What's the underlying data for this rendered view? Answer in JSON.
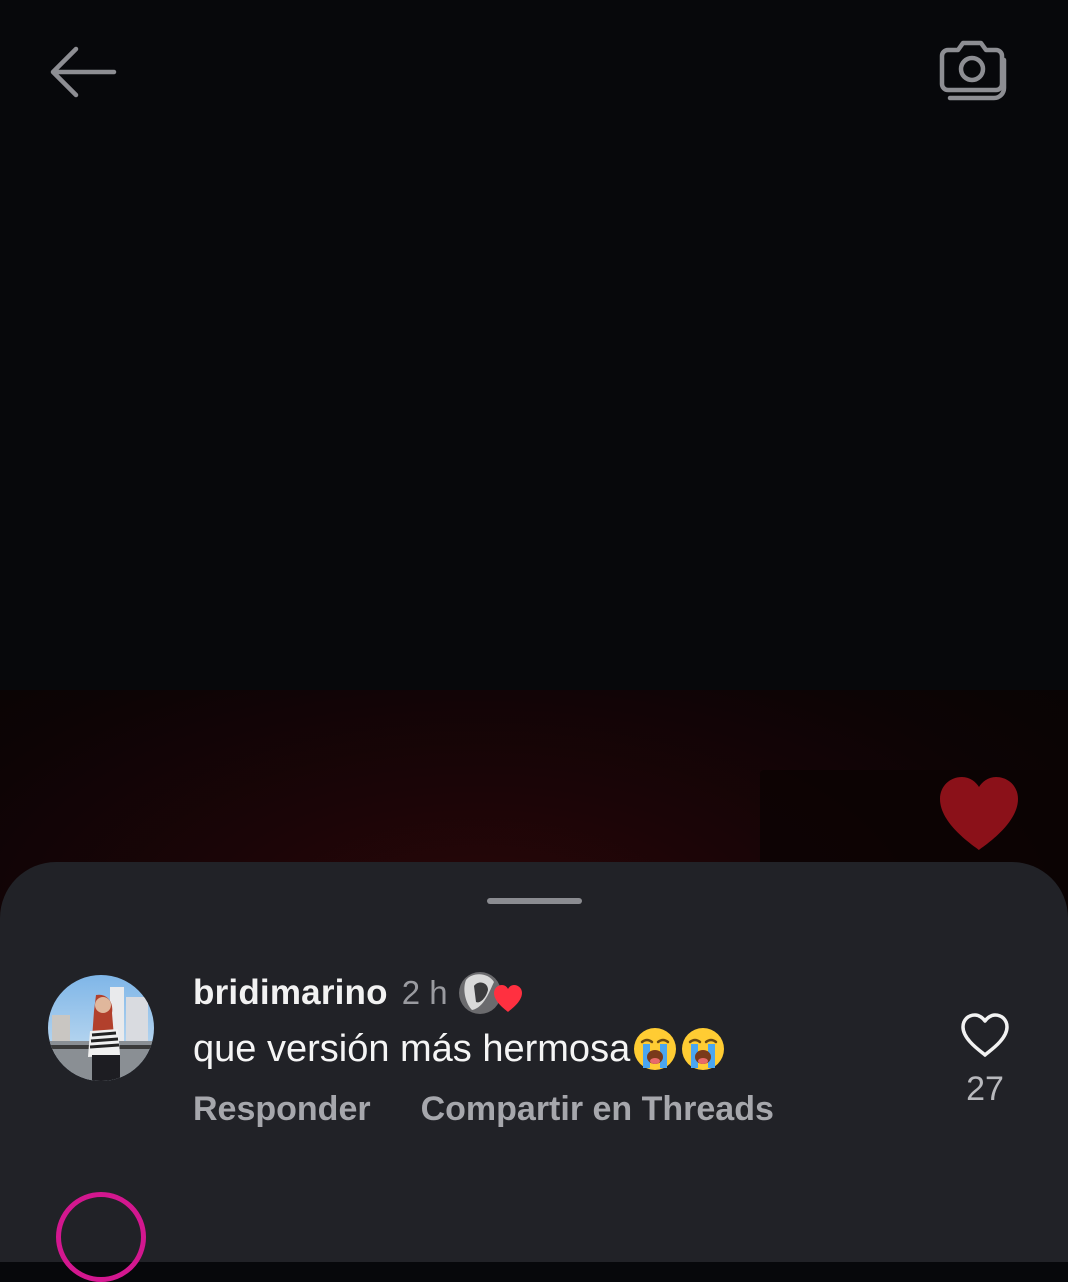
{
  "header": {
    "back_icon": "arrow-left-icon",
    "camera_icon": "camera-stack-icon"
  },
  "media": {
    "liked_icon": "heart-filled-icon",
    "accent_color": "#8b1119"
  },
  "comment": {
    "username": "bridimarino",
    "time": "2 h",
    "liked_by_author_icon": "author-avatar-heart-icon",
    "text": "que versión más hermosa",
    "emojis": [
      "loudly-crying-face",
      "loudly-crying-face"
    ],
    "reply_label": "Responder",
    "share_label": "Compartir en Threads",
    "like_icon": "heart-outline-icon",
    "like_count": "27"
  }
}
